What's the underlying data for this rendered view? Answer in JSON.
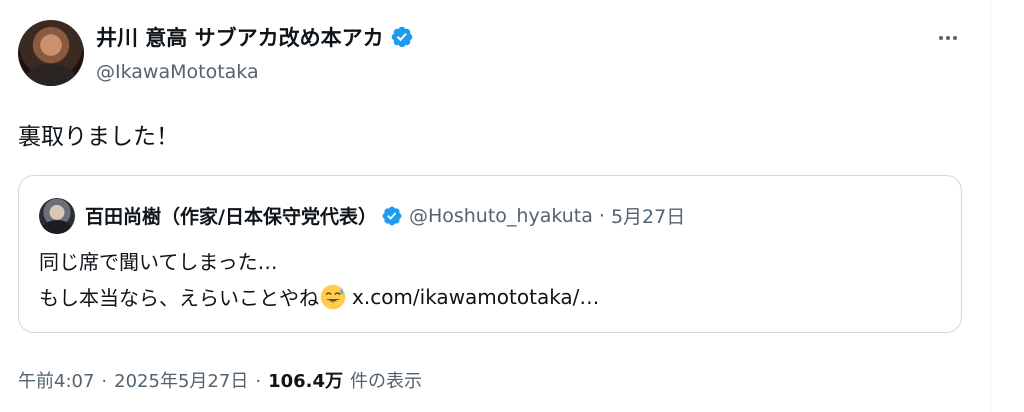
{
  "author": {
    "display_name": "井川 意高 サブアカ改め本アカ",
    "handle": "@IkawaMototaka",
    "verified_icon": "verified-badge-icon",
    "avatar_icon": "avatar"
  },
  "tweet": {
    "text": "裏取りました！"
  },
  "quote": {
    "display_name": "百田尚樹（作家/日本保守党代表）",
    "handle": "@Hoshuto_hyakuta",
    "separator": "·",
    "date": "5月27日",
    "line1": "同じ席で聞いてしまった…",
    "line2_text": "もし本当なら、えらいことやね",
    "line2_emoji": "sweat-smile-emoji-icon",
    "line2_link": "x.com/ikawamototaka/…"
  },
  "meta": {
    "time": "午前4:07",
    "sep1": "·",
    "date": "2025年5月27日",
    "sep2": "·",
    "views_count": "106.4万",
    "views_label": "件の表示"
  },
  "colors": {
    "text": "#0f1419",
    "secondary": "#536471",
    "verified": "#1d9bf0",
    "border": "#cfd9de"
  }
}
